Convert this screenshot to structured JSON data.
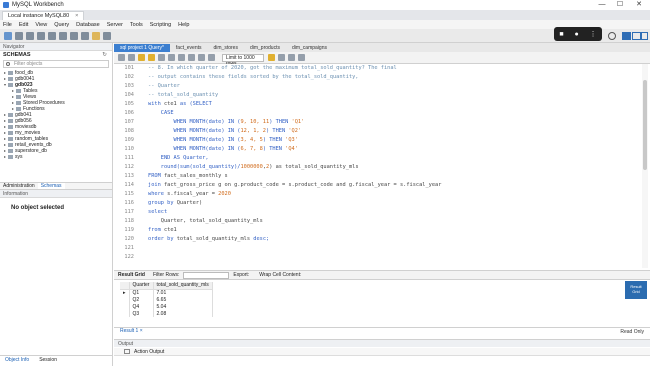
{
  "window": {
    "title": "MySQL Workbench",
    "min": "—",
    "max": "☐",
    "close": "✕"
  },
  "connection_tab": {
    "label": "Local instance MySQL80",
    "close": "×"
  },
  "menu": [
    "File",
    "Edit",
    "View",
    "Query",
    "Database",
    "Server",
    "Tools",
    "Scripting",
    "Help"
  ],
  "navigator": {
    "header": "Navigator",
    "schemas_title": "SCHEMAS",
    "filter_placeholder": "Filter objects",
    "tree": [
      {
        "label": "food_db",
        "level": 0,
        "expanded": false,
        "bold": false
      },
      {
        "label": "gdb0041",
        "level": 0,
        "expanded": false,
        "bold": false
      },
      {
        "label": "gdb023",
        "level": 0,
        "expanded": true,
        "bold": true
      },
      {
        "label": "Tables",
        "level": 1,
        "expanded": false,
        "bold": false
      },
      {
        "label": "Views",
        "level": 1,
        "expanded": false,
        "bold": false
      },
      {
        "label": "Stored Procedures",
        "level": 1,
        "expanded": false,
        "bold": false
      },
      {
        "label": "Functions",
        "level": 1,
        "expanded": false,
        "bold": false
      },
      {
        "label": "gdb041",
        "level": 0,
        "expanded": false,
        "bold": false
      },
      {
        "label": "gdb056",
        "level": 0,
        "expanded": false,
        "bold": false
      },
      {
        "label": "moviesdb",
        "level": 0,
        "expanded": false,
        "bold": false
      },
      {
        "label": "my_movies",
        "level": 0,
        "expanded": false,
        "bold": false
      },
      {
        "label": "random_tables",
        "level": 0,
        "expanded": false,
        "bold": false
      },
      {
        "label": "retail_events_db",
        "level": 0,
        "expanded": false,
        "bold": false
      },
      {
        "label": "superstore_db",
        "level": 0,
        "expanded": false,
        "bold": false
      },
      {
        "label": "sys",
        "level": 0,
        "expanded": false,
        "bold": false
      }
    ],
    "subtabs": [
      "Administration",
      "Schemas"
    ],
    "info_header": "Information",
    "no_object": "No object selected",
    "bottom_tabs": [
      "Object Info",
      "Session"
    ]
  },
  "sql_tabs": [
    "sql project 1 Query*",
    "fact_events",
    "dim_stores",
    "dim_products",
    "dim_campaigns"
  ],
  "editor_toolbar": {
    "limit": "Limit to 1000 rows"
  },
  "code_lines": [
    {
      "n": "101",
      "segs": [
        {
          "t": "-- 8. In which quarter of 2020, got the maximum total_sold_quantity? The final",
          "c": "cmt"
        }
      ]
    },
    {
      "n": "102",
      "segs": [
        {
          "t": "-- output contains these fields sorted by the total_sold_quantity,",
          "c": "cmt"
        }
      ]
    },
    {
      "n": "103",
      "segs": [
        {
          "t": "-- Quarter",
          "c": "cmt"
        }
      ]
    },
    {
      "n": "104",
      "segs": [
        {
          "t": "-- total_sold_quantity",
          "c": "cmt"
        }
      ]
    },
    {
      "n": "105",
      "segs": [
        {
          "t": "with ",
          "c": "kw"
        },
        {
          "t": "cte1 ",
          "c": "fn"
        },
        {
          "t": "as (SELECT",
          "c": "kw"
        }
      ]
    },
    {
      "n": "106",
      "segs": [
        {
          "t": "    CASE",
          "c": "kw"
        }
      ]
    },
    {
      "n": "107",
      "segs": [
        {
          "t": "        WHEN MONTH(date) IN (",
          "c": "kw"
        },
        {
          "t": "9, 10, 11",
          "c": "num"
        },
        {
          "t": ") THEN ",
          "c": "kw"
        },
        {
          "t": "'Q1'",
          "c": "str"
        }
      ]
    },
    {
      "n": "108",
      "segs": [
        {
          "t": "        WHEN MONTH(date) IN (",
          "c": "kw"
        },
        {
          "t": "12, 1, 2",
          "c": "num"
        },
        {
          "t": ") THEN ",
          "c": "kw"
        },
        {
          "t": "'Q2'",
          "c": "str"
        }
      ]
    },
    {
      "n": "109",
      "segs": [
        {
          "t": "        WHEN MONTH(date) IN (",
          "c": "kw"
        },
        {
          "t": "3, 4, 5",
          "c": "num"
        },
        {
          "t": ") THEN ",
          "c": "kw"
        },
        {
          "t": "'Q3'",
          "c": "str"
        }
      ]
    },
    {
      "n": "110",
      "segs": [
        {
          "t": "        WHEN MONTH(date) IN (",
          "c": "kw"
        },
        {
          "t": "6, 7, 8",
          "c": "num"
        },
        {
          "t": ") THEN ",
          "c": "kw"
        },
        {
          "t": "'Q4'",
          "c": "str"
        }
      ]
    },
    {
      "n": "111",
      "segs": [
        {
          "t": "    END AS Quarter,",
          "c": "kw"
        }
      ]
    },
    {
      "n": "112",
      "segs": [
        {
          "t": "    round(sum(sold_quantity)/",
          "c": "kw"
        },
        {
          "t": "1000000",
          "c": "num"
        },
        {
          "t": ",",
          "c": "fn"
        },
        {
          "t": "2",
          "c": "num"
        },
        {
          "t": ") as total_sold_quantity_mls",
          "c": "fn"
        }
      ]
    },
    {
      "n": "113",
      "segs": [
        {
          "t": "FROM ",
          "c": "kw"
        },
        {
          "t": "fact_sales_monthly s",
          "c": "fn"
        }
      ]
    },
    {
      "n": "114",
      "segs": [
        {
          "t": "join ",
          "c": "kw"
        },
        {
          "t": "fact_gross_price g on g.product_code = s.product_code and g.fiscal_year = s.fiscal_year",
          "c": "fn"
        }
      ]
    },
    {
      "n": "115",
      "segs": [
        {
          "t": "where ",
          "c": "kw"
        },
        {
          "t": "s.fiscal_year = ",
          "c": "fn"
        },
        {
          "t": "2020",
          "c": "num"
        }
      ]
    },
    {
      "n": "116",
      "segs": [
        {
          "t": "group by ",
          "c": "kw"
        },
        {
          "t": "Quarter)",
          "c": "fn"
        }
      ]
    },
    {
      "n": "117",
      "segs": [
        {
          "t": "select",
          "c": "kw"
        }
      ]
    },
    {
      "n": "118",
      "segs": [
        {
          "t": "    Quarter, total_sold_quantity_mls",
          "c": "fn"
        }
      ]
    },
    {
      "n": "119",
      "segs": [
        {
          "t": "from ",
          "c": "kw"
        },
        {
          "t": "cte1",
          "c": "fn"
        }
      ]
    },
    {
      "n": "120",
      "segs": [
        {
          "t": "order by ",
          "c": "kw"
        },
        {
          "t": "total_sold_quantity_mls ",
          "c": "fn"
        },
        {
          "t": "desc;",
          "c": "kw"
        }
      ]
    },
    {
      "n": "121",
      "segs": []
    },
    {
      "n": "122",
      "segs": []
    }
  ],
  "result_bar": {
    "result_grid": "Result Grid",
    "filter_rows": "Filter Rows:",
    "export": "Export:",
    "wrap": "Wrap Cell Content:"
  },
  "result_grid": {
    "columns": [
      "Quarter",
      "total_sold_quantity_mls"
    ],
    "rows": [
      [
        "Q1",
        "7.01"
      ],
      [
        "Q2",
        "6.65"
      ],
      [
        "Q4",
        "5.04"
      ],
      [
        "Q3",
        "2.08"
      ]
    ]
  },
  "side_result": {
    "label1": "Result",
    "label2": "Grid"
  },
  "result_tab": "Result 1 ×",
  "read_only": "Read Only",
  "output": {
    "header": "Output",
    "action": "Action Output"
  }
}
